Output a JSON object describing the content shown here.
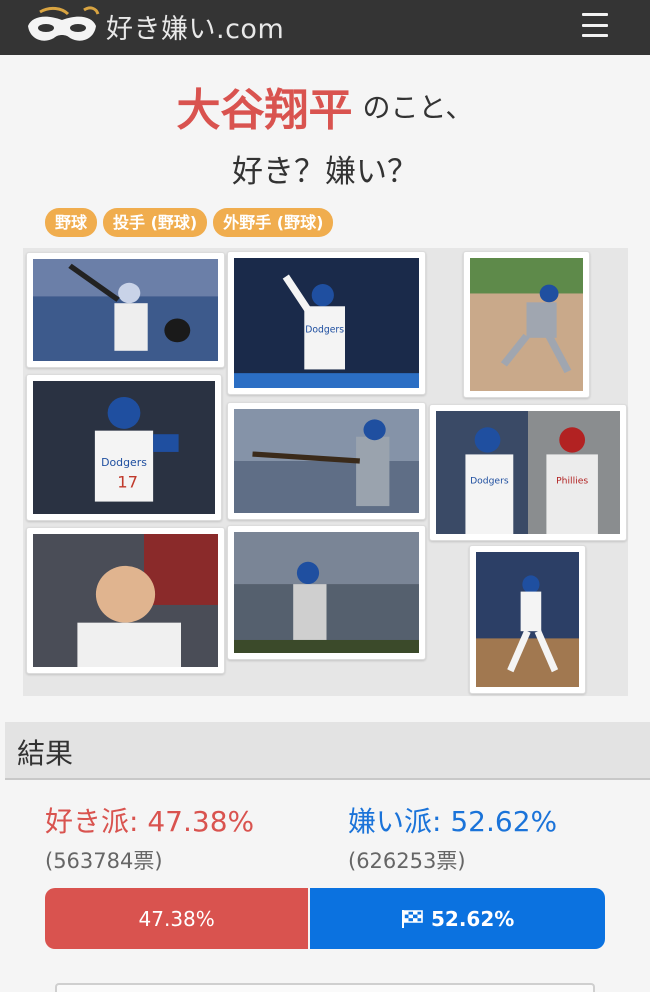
{
  "header": {
    "site_name": "好き嫌い.com",
    "logo_icon": "mask-logo-icon",
    "menu_icon": "hamburger-menu-icon"
  },
  "topic": {
    "name": "大谷翔平",
    "suffix": "のこと、",
    "question": "好き？嫌い？"
  },
  "tags": [
    "野球",
    "投手 (野球)",
    "外野手 (野球)"
  ],
  "gallery": {
    "photos": [
      {
        "description": "batting-at-bat"
      },
      {
        "description": "celebrating-dodgers-jersey"
      },
      {
        "description": "pitching-throw"
      },
      {
        "description": "dodgers-17-fist-pump"
      },
      {
        "description": "batting-swing-road-jersey"
      },
      {
        "description": "with-phillies-player"
      },
      {
        "description": "smiling-in-dugout"
      },
      {
        "description": "running-bases"
      },
      {
        "description": "swing-follow-through"
      }
    ]
  },
  "result": {
    "title": "結果",
    "like": {
      "label": "好き派",
      "percent_text": ": 47.38%",
      "count_text": "(563784票)",
      "bar_text": "47.38%",
      "percent": 47.38
    },
    "dislike": {
      "label": "嫌い派",
      "percent_text": ": 52.62%",
      "count_text": "(626253票)",
      "bar_text": "52.62%",
      "percent": 52.62
    }
  },
  "colors": {
    "like": "#d9534f",
    "dislike": "#0b72e0",
    "tag": "#f0ad4e",
    "header_bg": "#343434"
  }
}
